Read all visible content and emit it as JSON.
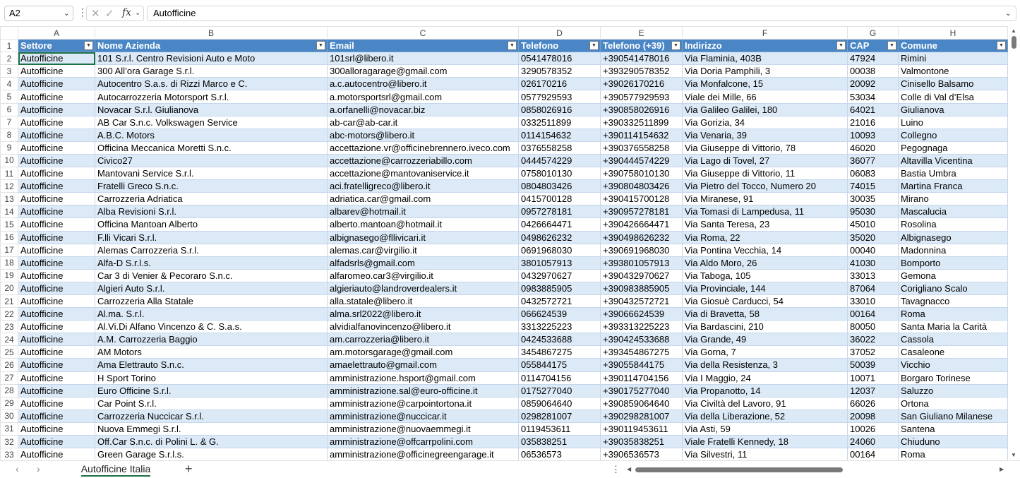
{
  "formula_bar": {
    "name_box": "A2",
    "formula": "Autofficine",
    "fx_label": "fx"
  },
  "columns": [
    "A",
    "B",
    "C",
    "D",
    "E",
    "F",
    "G",
    "H"
  ],
  "headers": [
    "Settore",
    "Nome Azienda",
    "Email",
    "Telefono",
    "Telefono (+39)",
    "Indirizzo",
    "CAP",
    "Comune"
  ],
  "rows": [
    [
      "Autofficine",
      "101 S.r.l. Centro Revisioni Auto e Moto",
      "101srl@libero.it",
      "0541478016",
      "+390541478016",
      "Via Flaminia, 403B",
      "47924",
      "Rimini"
    ],
    [
      "Autofficine",
      "300 All’ora Garage S.r.l.",
      "300alloragarage@gmail.com",
      "3290578352",
      "+393290578352",
      "Via Doria Pamphili, 3",
      "00038",
      "Valmontone"
    ],
    [
      "Autofficine",
      "Autocentro S.a.s. di Rizzi Marco e C.",
      "a.c.autocentro@libero.it",
      "026170216",
      "+39026170216",
      "Via Monfalcone, 15",
      "20092",
      "Cinisello Balsamo"
    ],
    [
      "Autofficine",
      "Autocarrozzeria Motorsport S.r.l.",
      "a.motorsportsrl@gmail.com",
      "0577929593",
      "+390577929593",
      "Viale dei Mille, 66",
      "53034",
      "Colle di Val d’Elsa"
    ],
    [
      "Autofficine",
      "Novacar S.r.l. Giulianova",
      "a.orfanelli@novacar.biz",
      "0858026916",
      "+390858026916",
      "Via Galileo Galilei, 180",
      "64021",
      "Giulianova"
    ],
    [
      "Autofficine",
      "AB Car S.n.c. Volkswagen Service",
      "ab-car@ab-car.it",
      "0332511899",
      "+390332511899",
      "Via Gorizia, 34",
      "21016",
      "Luino"
    ],
    [
      "Autofficine",
      "A.B.C. Motors",
      "abc-motors@libero.it",
      "0114154632",
      "+390114154632",
      "Via Venaria, 39",
      "10093",
      "Collegno"
    ],
    [
      "Autofficine",
      "Officina Meccanica Moretti S.n.c.",
      "accettazione.vr@officinebrennero.iveco.com",
      "0376558258",
      "+390376558258",
      "Via Giuseppe di Vittorio, 78",
      "46020",
      "Pegognaga"
    ],
    [
      "Autofficine",
      "Civico27",
      "accettazione@carrozzeriabillo.com",
      "0444574229",
      "+390444574229",
      "Via Lago di Tovel, 27",
      "36077",
      "Altavilla Vicentina"
    ],
    [
      "Autofficine",
      "Mantovani Service S.r.l.",
      "accettazione@mantovaniservice.it",
      "0758010130",
      "+390758010130",
      "Via Giuseppe di Vittorio, 11",
      "06083",
      "Bastia Umbra"
    ],
    [
      "Autofficine",
      "Fratelli Greco S.n.c.",
      "aci.fratelligreco@libero.it",
      "0804803426",
      "+390804803426",
      "Via Pietro del Tocco, Numero 20",
      "74015",
      "Martina Franca"
    ],
    [
      "Autofficine",
      "Carrozzeria Adriatica",
      "adriatica.car@gmail.com",
      "0415700128",
      "+390415700128",
      "Via Miranese, 91",
      "30035",
      "Mirano"
    ],
    [
      "Autofficine",
      "Alba Revisioni S.r.l.",
      "albarev@hotmail.it",
      "0957278181",
      "+390957278181",
      "Via Tomasi di Lampedusa, 11",
      "95030",
      "Mascalucia"
    ],
    [
      "Autofficine",
      "Officina Mantoan Alberto",
      "alberto.mantoan@hotmail.it",
      "0426664471",
      "+390426664471",
      "Via Santa Teresa, 23",
      "45010",
      "Rosolina"
    ],
    [
      "Autofficine",
      "F.lli Vicari S.r.l.",
      "albignasego@fllivicari.it",
      "0498626232",
      "+390498626232",
      "Via Roma, 22",
      "35020",
      "Albignasego"
    ],
    [
      "Autofficine",
      "Alemas Carrozzeria S.r.l.",
      "alemas.car@virgilio.it",
      "0691968030",
      "+390691968030",
      "Via Pontina Vecchia, 14",
      "00040",
      "Madonnina"
    ],
    [
      "Autofficine",
      "Alfa-D S.r.l.s.",
      "alfadsrls@gmail.com",
      "3801057913",
      "+393801057913",
      "Via Aldo Moro, 26",
      "41030",
      "Bomporto"
    ],
    [
      "Autofficine",
      "Car 3 di Venier & Pecoraro S.n.c.",
      "alfaromeo.car3@virgilio.it",
      "0432970627",
      "+390432970627",
      "Via Taboga, 105",
      "33013",
      "Gemona"
    ],
    [
      "Autofficine",
      "Algieri Auto S.r.l.",
      "algieriauto@landroverdealers.it",
      "0983885905",
      "+390983885905",
      "Via Provinciale, 144",
      "87064",
      "Corigliano Scalo"
    ],
    [
      "Autofficine",
      "Carrozzeria Alla Statale",
      "alla.statale@libero.it",
      "0432572721",
      "+390432572721",
      "Via Giosuè Carducci, 54",
      "33010",
      "Tavagnacco"
    ],
    [
      "Autofficine",
      "Al.ma. S.r.l.",
      "alma.srl2022@libero.it",
      "066624539",
      "+39066624539",
      "Via di Bravetta, 58",
      "00164",
      "Roma"
    ],
    [
      "Autofficine",
      "Al.Vi.Di Alfano Vincenzo & C. S.a.s.",
      "alvidialfanovincenzo@libero.it",
      "3313225223",
      "+393313225223",
      "Via Bardascini, 210",
      "80050",
      "Santa Maria la Carità"
    ],
    [
      "Autofficine",
      "A.M. Carrozzeria Baggio",
      "am.carrozzeria@libero.it",
      "0424533688",
      "+390424533688",
      "Via Grande, 49",
      "36022",
      "Cassola"
    ],
    [
      "Autofficine",
      "AM Motors",
      "am.motorsgarage@gmail.com",
      "3454867275",
      "+393454867275",
      "Via Gorna, 7",
      "37052",
      "Casaleone"
    ],
    [
      "Autofficine",
      "Ama Elettrauto S.n.c.",
      "amaelettrauto@gmail.com",
      "055844175",
      "+39055844175",
      "Via della Resistenza, 3",
      "50039",
      "Vicchio"
    ],
    [
      "Autofficine",
      "H Sport Torino",
      "amministrazione.hsport@gmail.com",
      "0114704156",
      "+390114704156",
      "Via I Maggio, 24",
      "10071",
      "Borgaro Torinese"
    ],
    [
      "Autofficine",
      "Euro Officine S.r.l.",
      "amministrazione.sal@euro-officine.it",
      "0175277040",
      "+390175277040",
      "Via Propanotto, 14",
      "12037",
      "Saluzzo"
    ],
    [
      "Autofficine",
      "Car Point S.r.l.",
      "amministrazione@carpointortona.it",
      "0859064640",
      "+390859064640",
      "Via Civiltà del Lavoro, 91",
      "66026",
      "Ortona"
    ],
    [
      "Autofficine",
      "Carrozzeria Nuccicar S.r.l.",
      "amministrazione@nuccicar.it",
      "0298281007",
      "+390298281007",
      "Via della Liberazione, 52",
      "20098",
      "San Giuliano Milanese"
    ],
    [
      "Autofficine",
      "Nuova Emmegi S.r.l.",
      "amministrazione@nuovaemmegi.it",
      "0119453611",
      "+390119453611",
      "Via Asti, 59",
      "10026",
      "Santena"
    ],
    [
      "Autofficine",
      "Off.Car S.n.c. di Polini L. & G.",
      "amministrazione@offcarrpolini.com",
      "035838251",
      "+39035838251",
      "Viale Fratelli Kennedy, 18",
      "24060",
      "Chiuduno"
    ],
    [
      "Autofficine",
      "Green Garage S.r.l.s.",
      "amministrazione@officinegreengarage.it",
      "06536573",
      "+3906536573",
      "Via Silvestri, 11",
      "00164",
      "Roma"
    ]
  ],
  "sheet_tab": "Autofficine Italia",
  "colors": {
    "header": "#4a86c5",
    "band": "#dce9f6",
    "accent": "#1e7145"
  }
}
